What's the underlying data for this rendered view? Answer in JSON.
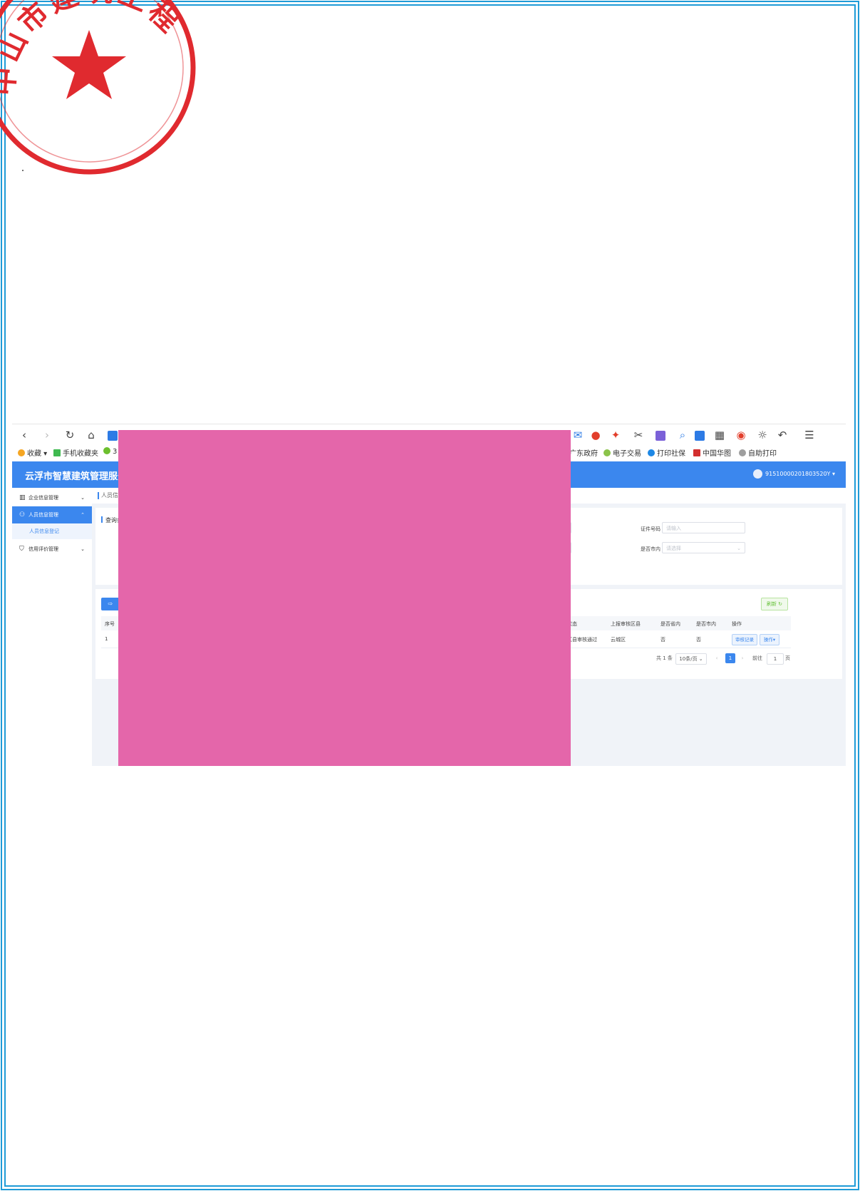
{
  "seal": {
    "text": "中山市建筑工程有限公司",
    "color": "#e02a2f"
  },
  "bookmarks": {
    "favorites": "收藏",
    "mobile": "手机收藏夹",
    "item3": "3",
    "gd_gov": "广东政府",
    "e_trade": "电子交易",
    "print_social": "打印社保",
    "china_hua": "中国华图",
    "self_print": "自助打印"
  },
  "header": {
    "title": "云浮市智慧建筑管理服务信",
    "user": "91510000201803520Y ▾"
  },
  "sidebar": {
    "items": [
      {
        "label": "企业信息管理",
        "icon": "building-icon",
        "chevron": "⌄"
      },
      {
        "label": "人员信息管理",
        "icon": "people-icon",
        "chevron": "⌃"
      },
      {
        "label": "信用评价管理",
        "icon": "shield-icon",
        "chevron": "⌄"
      }
    ],
    "sub_item": "人员信息登记"
  },
  "breadcrumb": "人员信",
  "query": {
    "title": "查询条",
    "id_label": "证件号码",
    "id_placeholder": "请输入",
    "in_city_label": "是否市内",
    "in_city_placeholder": "请选择"
  },
  "toolbar_buttons": {
    "export": "⇨",
    "refresh": "刷新 ↻"
  },
  "table": {
    "headers": {
      "index": "序号",
      "status": "审核状态",
      "region": "上报审核区县",
      "in_province": "是否省内",
      "in_city": "是否市内",
      "action": "操作"
    },
    "rows": [
      {
        "index": "1",
        "status": "初审区县审核通过",
        "region": "云城区",
        "in_province": "否",
        "in_city": "否",
        "btn_record": "审核记录",
        "btn_action": "操作▾"
      }
    ]
  },
  "pagination": {
    "total": "共 1 条",
    "per_page": "10条/页",
    "prev": "‹",
    "current": "1",
    "next": "›",
    "goto": "前往",
    "page_value": "1",
    "page_unit": "页"
  },
  "colors": {
    "frame": "#1f9bd7",
    "header": "#3b87ee",
    "redaction": "#e466aa"
  }
}
